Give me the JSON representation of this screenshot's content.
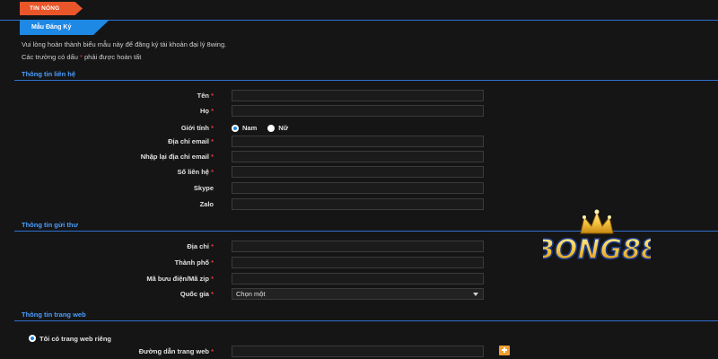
{
  "top": {
    "news_tab": "TIN NÓNG",
    "form_tab": "Mẫu Đăng Ký"
  },
  "intro": {
    "line1": "Vui lòng hoàn thành biểu mẫu này để đăng ký tài khoản đại lý 8wing.",
    "line2_before": "Các trường có dấu ",
    "line2_star": "*",
    "line2_after": " phải được hoàn tất"
  },
  "sections": {
    "contact": "Thông tin liên hệ",
    "mailing": "Thông tin gửi thư",
    "website": "Thông tin trang web"
  },
  "contact_fields": {
    "first_name": "Tên",
    "last_name": "Họ",
    "gender": "Giới tính",
    "email": "Địa chỉ email",
    "email_confirm": "Nhập lại địa chỉ email",
    "phone": "Số liên hệ",
    "skype": "Skype",
    "zalo": "Zalo"
  },
  "gender_options": {
    "male": "Nam",
    "female": "Nữ"
  },
  "mailing_fields": {
    "address": "Địa chỉ",
    "city": "Thành phố",
    "postal": "Mã bưu điện/Mã zip",
    "country": "Quốc gia"
  },
  "country_select": {
    "selected": "Chọn một"
  },
  "website": {
    "own_site": "Tôi có trang web riêng",
    "url_label": "Đường dẫn trang web"
  },
  "required_mark": "*",
  "logo": {
    "text": "BONG88"
  },
  "colors": {
    "background": "#151515",
    "accent_blue": "#1e88e5",
    "section_blue": "#4a9eff",
    "hot_orange": "#e8562a",
    "required_red": "#e53935",
    "logo_gold": "#f5c542"
  }
}
